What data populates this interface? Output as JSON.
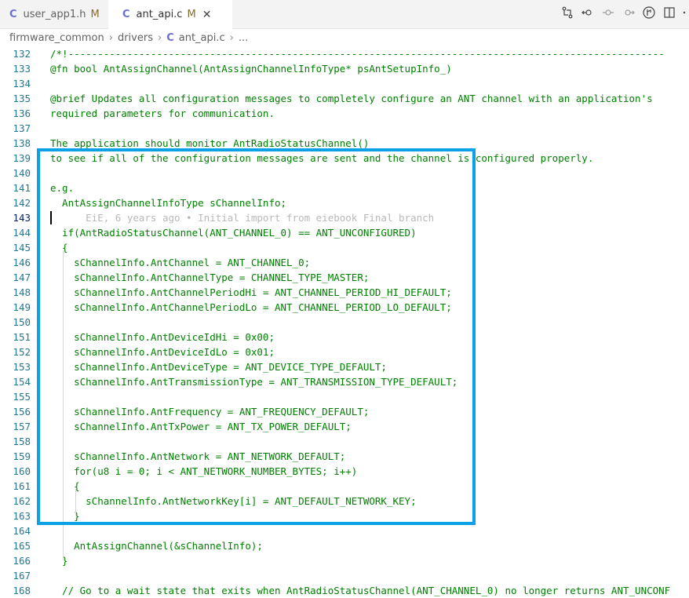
{
  "tabs": [
    {
      "icon": "C",
      "label": "user_app1.h",
      "status": "M",
      "active": false
    },
    {
      "icon": "C",
      "label": "ant_api.c",
      "status": "M",
      "active": true
    }
  ],
  "breadcrumb": [
    "firmware_common",
    "drivers",
    "ant_api.c",
    "..."
  ],
  "close_glyph": "✕",
  "colors": {
    "accent_box": "#0aa1e6",
    "comment": "#008000",
    "line_number": "#237893"
  },
  "editor": {
    "lines": [
      {
        "n": "132",
        "text": "/*!-----------------------------------------------------------------------------------------------------"
      },
      {
        "n": "133",
        "text": "@fn bool AntAssignChannel(AntAssignChannelInfoType* psAntSetupInfo_)"
      },
      {
        "n": "134",
        "text": ""
      },
      {
        "n": "135",
        "text": "@brief Updates all configuration messages to completely configure an ANT channel with an application's"
      },
      {
        "n": "136",
        "text": "required parameters for communication."
      },
      {
        "n": "137",
        "text": ""
      },
      {
        "n": "138",
        "text": "The application should monitor AntRadioStatusChannel()"
      },
      {
        "n": "139",
        "text": "to see if all of the configuration messages are sent and the channel is configured properly."
      },
      {
        "n": "140",
        "text": ""
      },
      {
        "n": "141",
        "text": "e.g."
      },
      {
        "n": "142",
        "text": "  AntAssignChannelInfoType sChannelInfo;"
      },
      {
        "n": "143",
        "text": "      EiE, 6 years ago • Initial import from eiebook Final branch"
      },
      {
        "n": "144",
        "text": "  if(AntRadioStatusChannel(ANT_CHANNEL_0) == ANT_UNCONFIGURED)"
      },
      {
        "n": "145",
        "text": "  {"
      },
      {
        "n": "146",
        "text": "    sChannelInfo.AntChannel = ANT_CHANNEL_0;"
      },
      {
        "n": "147",
        "text": "    sChannelInfo.AntChannelType = CHANNEL_TYPE_MASTER;"
      },
      {
        "n": "148",
        "text": "    sChannelInfo.AntChannelPeriodHi = ANT_CHANNEL_PERIOD_HI_DEFAULT;"
      },
      {
        "n": "149",
        "text": "    sChannelInfo.AntChannelPeriodLo = ANT_CHANNEL_PERIOD_LO_DEFAULT;"
      },
      {
        "n": "150",
        "text": ""
      },
      {
        "n": "151",
        "text": "    sChannelInfo.AntDeviceIdHi = 0x00;"
      },
      {
        "n": "152",
        "text": "    sChannelInfo.AntDeviceIdLo = 0x01;"
      },
      {
        "n": "153",
        "text": "    sChannelInfo.AntDeviceType = ANT_DEVICE_TYPE_DEFAULT;"
      },
      {
        "n": "154",
        "text": "    sChannelInfo.AntTransmissionType = ANT_TRANSMISSION_TYPE_DEFAULT;"
      },
      {
        "n": "155",
        "text": ""
      },
      {
        "n": "156",
        "text": "    sChannelInfo.AntFrequency = ANT_FREQUENCY_DEFAULT;"
      },
      {
        "n": "157",
        "text": "    sChannelInfo.AntTxPower = ANT_TX_POWER_DEFAULT;"
      },
      {
        "n": "158",
        "text": ""
      },
      {
        "n": "159",
        "text": "    sChannelInfo.AntNetwork = ANT_NETWORK_DEFAULT;"
      },
      {
        "n": "160",
        "text": "    for(u8 i = 0; i < ANT_NETWORK_NUMBER_BYTES; i++)"
      },
      {
        "n": "161",
        "text": "    {"
      },
      {
        "n": "162",
        "text": "      sChannelInfo.AntNetworkKey[i] = ANT_DEFAULT_NETWORK_KEY;"
      },
      {
        "n": "163",
        "text": "    }"
      },
      {
        "n": "164",
        "text": ""
      },
      {
        "n": "165",
        "text": "    AntAssignChannel(&sChannelInfo);"
      },
      {
        "n": "166",
        "text": "  }"
      },
      {
        "n": "167",
        "text": ""
      },
      {
        "n": "168",
        "text": "  // Go to a wait state that exits when AntRadioStatusChannel(ANT_CHANNEL_0) no longer returns ANT_UNCONF"
      }
    ],
    "current_line": "143"
  }
}
